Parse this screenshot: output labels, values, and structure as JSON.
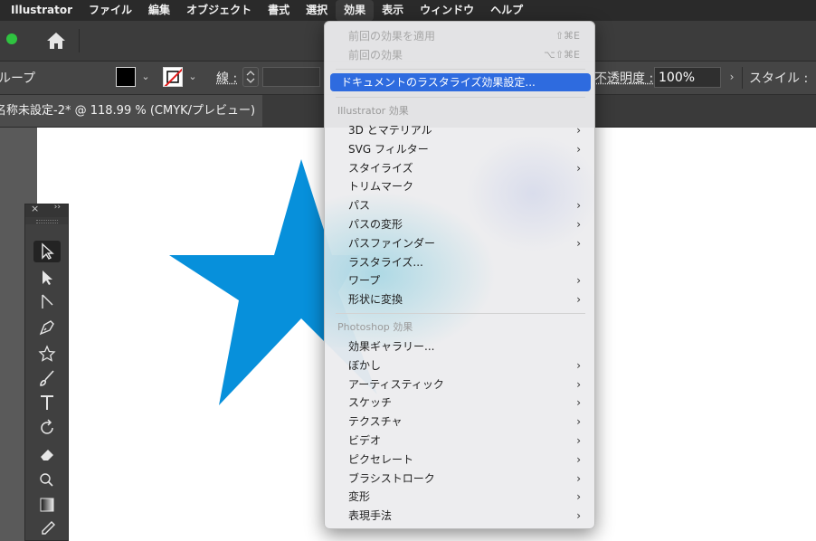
{
  "menubar": {
    "items": [
      "Illustrator",
      "ファイル",
      "編集",
      "オブジェクト",
      "書式",
      "選択",
      "効果",
      "表示",
      "ウィンドウ",
      "ヘルプ"
    ],
    "active": "効果"
  },
  "control_bar": {
    "selection_label": "ループ",
    "stroke_label": "線 :",
    "opacity_label": "不透明度 :",
    "opacity_value": "100%",
    "style_label": "スタイル :"
  },
  "document_tab": {
    "title": "名称未設定-2* @ 118.99 % (CMYK/プレビュー)"
  },
  "colors": {
    "star": "#0790db",
    "highlight": "#2e6bdf"
  },
  "effect_menu": {
    "apply_last": "前回の効果を適用",
    "apply_last_shortcut": "⇧⌘E",
    "last_effect": "前回の効果",
    "last_effect_shortcut": "⌥⇧⌘E",
    "raster_settings": "ドキュメントのラスタライズ効果設定...",
    "illustrator_header": "Illustrator 効果",
    "illustrator_items": [
      "3D とマテリアル",
      "SVG フィルター",
      "スタイライズ",
      "トリムマーク",
      "パス",
      "パスの変形",
      "パスファインダー",
      "ラスタライズ...",
      "ワープ",
      "形状に変換"
    ],
    "photoshop_header": "Photoshop 効果",
    "photoshop_items": [
      "効果ギャラリー...",
      "ぼかし",
      "アーティスティック",
      "スケッチ",
      "テクスチャ",
      "ビデオ",
      "ピクセレート",
      "ブラシストローク",
      "変形",
      "表現手法"
    ]
  }
}
